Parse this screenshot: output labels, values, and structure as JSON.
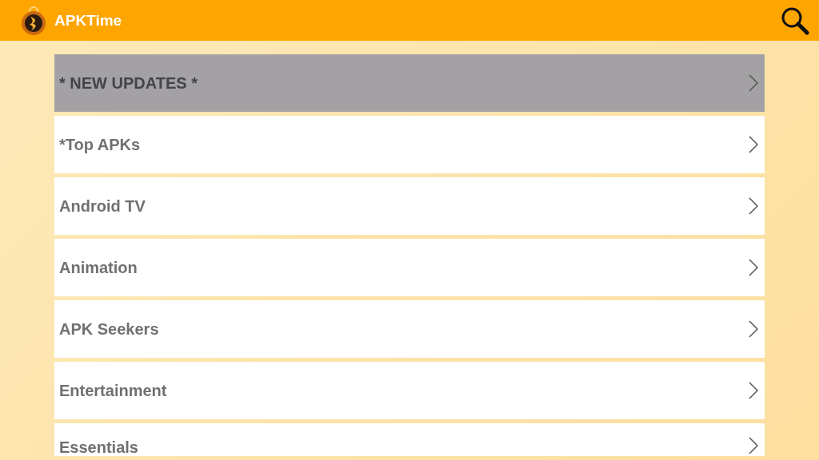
{
  "app_bar": {
    "title": "APKTime"
  },
  "categories": [
    {
      "label": "* NEW UPDATES *",
      "selected": true
    },
    {
      "label": "*Top APKs",
      "selected": false
    },
    {
      "label": "Android TV",
      "selected": false
    },
    {
      "label": "Animation",
      "selected": false
    },
    {
      "label": "APK Seekers",
      "selected": false
    },
    {
      "label": "Entertainment",
      "selected": false
    },
    {
      "label": "Essentials",
      "selected": false
    }
  ]
}
